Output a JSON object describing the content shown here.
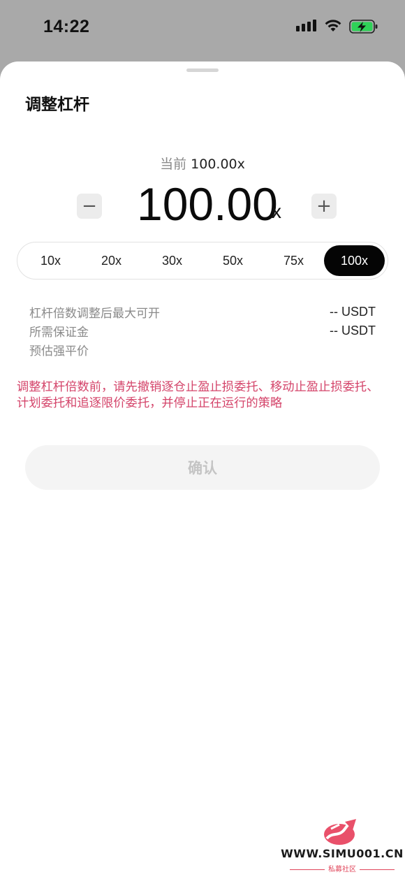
{
  "status_bar": {
    "time": "14:22",
    "battery_color": "#2fd158"
  },
  "sheet": {
    "title": "调整杠杆"
  },
  "leverage": {
    "current_label": "当前",
    "current_value": "100.00x",
    "value": "100.00",
    "unit": "x",
    "minus_label": "−",
    "plus_label": "+"
  },
  "presets": [
    {
      "label": "10x",
      "selected": false
    },
    {
      "label": "20x",
      "selected": false
    },
    {
      "label": "30x",
      "selected": false
    },
    {
      "label": "50x",
      "selected": false
    },
    {
      "label": "75x",
      "selected": false
    },
    {
      "label": "100x",
      "selected": true
    }
  ],
  "info": {
    "rows": [
      {
        "label": "杠杆倍数调整后最大可开",
        "value": "-- USDT"
      },
      {
        "label": "所需保证金",
        "value": "-- USDT"
      },
      {
        "label": "预估强平价",
        "value": ""
      }
    ]
  },
  "warning": "调整杠杆倍数前，请先撤销逐仓止盈止损委托、移动止盈止损委托、计划委托和追逐限价委托，并停止正在运行的策略",
  "confirm_label": "确认",
  "watermark": {
    "site": "WWW.SIMU001.CN",
    "subtitle": "私募社区"
  },
  "colors": {
    "warning": "#d4446a",
    "selected_preset": "#050505",
    "confirm_disabled_bg": "#f4f4f4"
  }
}
